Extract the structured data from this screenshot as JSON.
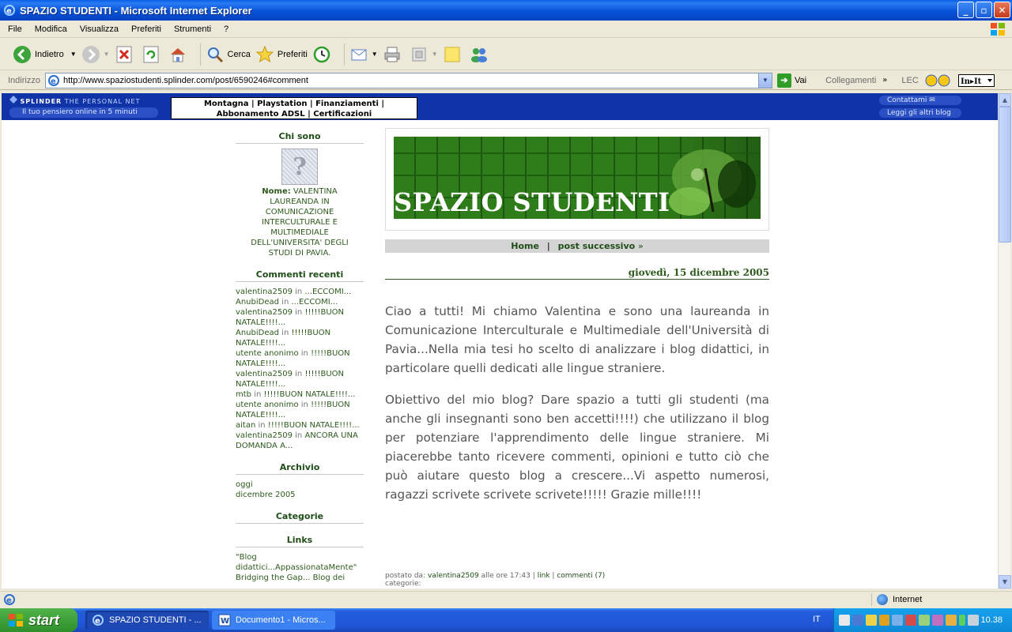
{
  "window": {
    "title": "SPAZIO STUDENTI - Microsoft Internet Explorer",
    "min": "_",
    "max": "▫",
    "close": "✕"
  },
  "menu": [
    "File",
    "Modifica",
    "Visualizza",
    "Preferiti",
    "Strumenti",
    "?"
  ],
  "toolbar": {
    "back": "Indietro",
    "search": "Cerca",
    "favorites": "Preferiti"
  },
  "address": {
    "label": "Indirizzo",
    "url": "http://www.spaziostudenti.splinder.com/post/6590246#comment",
    "go": "Vai",
    "links": "Collegamenti",
    "lec": "LEC"
  },
  "splinder": {
    "logo_brand": "SPLINDER",
    "logo_sub": "THE PERSONAL NET",
    "tagline": "Il tuo pensiero online in 5 minuti",
    "ad_line1": "Montagna | Playstation | Finanziamenti |",
    "ad_line2": "Abbonamento ADSL | Certificazioni",
    "contact": "Contattami",
    "read_blogs": "Leggi gli altri blog"
  },
  "sidebar": {
    "about_title": "Chi sono",
    "name_label": "Nome:",
    "name_text": "VALENTINA LAUREANDA IN COMUNICAZIONE INTERCULTURALE E MULTIMEDIALE DELL'UNIVERSITA' DEGLI STUDI DI PAVIA.",
    "recent_title": "Commenti recenti",
    "recent": [
      {
        "who": "valentina2509",
        "in": "in",
        "what": "...ECCOMI..."
      },
      {
        "who": "AnubiDead",
        "in": "in",
        "what": "...ECCOMI..."
      },
      {
        "who": "valentina2509",
        "in": "in",
        "what": "!!!!!BUON NATALE!!!!..."
      },
      {
        "who": "AnubiDead",
        "in": "in",
        "what": "!!!!!BUON NATALE!!!!..."
      },
      {
        "who": "utente anonimo",
        "in": "in",
        "what": "!!!!!BUON NATALE!!!!..."
      },
      {
        "who": "valentina2509",
        "in": "in",
        "what": "!!!!!BUON NATALE!!!!..."
      },
      {
        "who": "mtb",
        "in": "in",
        "what": "!!!!!BUON NATALE!!!!..."
      },
      {
        "who": "utente anonimo",
        "in": "in",
        "what": "!!!!!BUON NATALE!!!!..."
      },
      {
        "who": "aitan",
        "in": "in",
        "what": "!!!!!BUON NATALE!!!!..."
      },
      {
        "who": "valentina2509",
        "in": "in",
        "what": "ANCORA UNA DOMANDA A..."
      }
    ],
    "archive_title": "Archivio",
    "archive": [
      "oggi",
      "dicembre 2005"
    ],
    "categories_title": "Categorie",
    "links_title": "Links",
    "links": [
      "\"Blog didattici...AppassionataMente\"",
      "Bridging the Gap... Blog dei"
    ]
  },
  "main": {
    "header_title": "SPAZIO STUDENTI",
    "nav_home": "Home",
    "nav_sep": "|",
    "nav_next": "post successivo",
    "nav_arrow": "»",
    "date": "giovedì, 15 dicembre 2005",
    "para1": "Ciao a tutti! Mi chiamo Valentina e sono una laureanda in Comunicazione Interculturale e Multimediale dell'Università di Pavia...Nella mia tesi ho scelto di analizzare i blog didattici, in particolare quelli dedicati alle lingue straniere.",
    "para2": "Obiettivo del mio blog? Dare spazio a tutti gli studenti (ma anche gli insegnanti sono ben accetti!!!!) che utilizzano il blog per potenziare l'apprendimento delle lingue straniere. Mi piacerebbe tanto ricevere commenti, opinioni e tutto ciò che può aiutare questo blog a crescere...Vi aspetto numerosi, ragazzi scrivete scrivete scrivete!!!!! Grazie mille!!!!",
    "meta_prefix": "postato da:",
    "meta_author": "valentina2509",
    "meta_time": "alle ore 17:43",
    "meta_link": "link",
    "meta_comments": "commenti (7)",
    "meta_categories": "categorie:"
  },
  "status": {
    "zone": "Internet"
  },
  "taskbar": {
    "start": "start",
    "task1": "SPAZIO STUDENTI - ...",
    "task2": "Documento1 - Micros...",
    "lang": "IT",
    "clock": "10.38"
  }
}
